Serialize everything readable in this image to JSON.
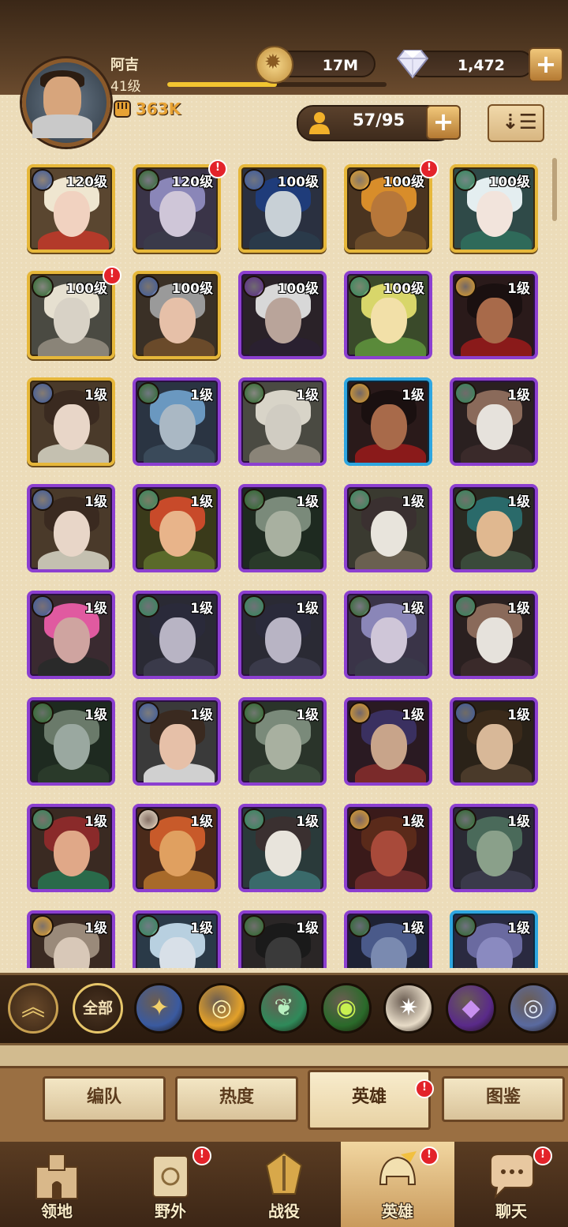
{
  "player": {
    "name": "阿吉",
    "level": "41级",
    "power": "363K",
    "xp_fraction": 0.5
  },
  "resources": {
    "gold": "17M",
    "gems": "1,472",
    "plus": "+"
  },
  "roster": {
    "count": "57/95",
    "plus": "+"
  },
  "heroes": [
    {
      "level": "120级",
      "frame": "gold",
      "faction": "celestial",
      "alert": false,
      "skin": "#f1d2c0",
      "hair": "#efe6d0",
      "body": "#b33a2a",
      "bg": "#5a4630"
    },
    {
      "level": "120级",
      "frame": "gold",
      "faction": "graveborn",
      "alert": true,
      "skin": "#cfc6d8",
      "hair": "#8a86b8",
      "body": "#3a3a4a",
      "bg": "#3a3448"
    },
    {
      "level": "100级",
      "frame": "gold",
      "faction": "celestial",
      "alert": false,
      "skin": "#c8d0d6",
      "hair": "#1f3c7a",
      "body": "#2a3a4a",
      "bg": "#2a3040"
    },
    {
      "level": "100级",
      "frame": "gold",
      "faction": "lightbearer",
      "alert": true,
      "skin": "#b7773a",
      "hair": "#d88d2a",
      "body": "#6a4b2a",
      "bg": "#4a3420"
    },
    {
      "level": "100级",
      "frame": "gold",
      "faction": "wilder",
      "alert": false,
      "skin": "#f2e4dc",
      "hair": "#e4eef0",
      "body": "#2f6a5a",
      "bg": "#2f4a48"
    },
    {
      "level": "100级",
      "frame": "gold",
      "faction": "graveborn",
      "alert": true,
      "skin": "#d8d2c6",
      "hair": "#e6e0d0",
      "body": "#8a8478",
      "bg": "#4a4a42"
    },
    {
      "level": "100级",
      "frame": "gold",
      "faction": "celestial",
      "alert": false,
      "skin": "#e6c0a8",
      "hair": "#9a9a9a",
      "body": "#6a4a2a",
      "bg": "#3a3026"
    },
    {
      "level": "100级",
      "frame": "purple",
      "faction": "hypogean",
      "alert": false,
      "skin": "#b9a49a",
      "hair": "#d8d8d8",
      "body": "#2a2030",
      "bg": "#2a2228"
    },
    {
      "level": "100级",
      "frame": "purple",
      "faction": "wilder",
      "alert": false,
      "skin": "#f2e0a8",
      "hair": "#d8d66a",
      "body": "#5a8a3a",
      "bg": "#3a4a2a"
    },
    {
      "level": "1级",
      "frame": "purple",
      "faction": "lightbearer",
      "alert": false,
      "skin": "#a86a4a",
      "hair": "#1a1010",
      "body": "#8a1a1a",
      "bg": "#2a1a1a"
    },
    {
      "level": "1级",
      "frame": "gold",
      "faction": "celestial",
      "alert": false,
      "skin": "#e8d6c8",
      "hair": "#3a2a20",
      "body": "#c4c0b0",
      "bg": "#4a3a2a"
    },
    {
      "level": "1级",
      "frame": "purple",
      "faction": "graveborn",
      "alert": false,
      "skin": "#aab8c4",
      "hair": "#6a98c0",
      "body": "#3a4a5a",
      "bg": "#2a3442"
    },
    {
      "level": "1级",
      "frame": "purple",
      "faction": "graveborn",
      "alert": false,
      "skin": "#d0ccc2",
      "hair": "#d8d4c8",
      "body": "#8a8478",
      "bg": "#4a4a42"
    },
    {
      "level": "1级",
      "frame": "blue",
      "faction": "lightbearer",
      "alert": false,
      "skin": "#a86a4a",
      "hair": "#1a1010",
      "body": "#8a1a1a",
      "bg": "#2a1a1a"
    },
    {
      "level": "1级",
      "frame": "purple",
      "faction": "wilder",
      "alert": false,
      "skin": "#e6e2dc",
      "hair": "#8a6a5a",
      "body": "#3a2a2a",
      "bg": "#2a2020"
    },
    {
      "level": "1级",
      "frame": "purple",
      "faction": "celestial",
      "alert": false,
      "skin": "#e8d6c8",
      "hair": "#3a2a20",
      "body": "#c4c0b0",
      "bg": "#4a3a2a"
    },
    {
      "level": "1级",
      "frame": "purple",
      "faction": "wilder",
      "alert": false,
      "skin": "#e8b48a",
      "hair": "#c84a2a",
      "body": "#5a6a2a",
      "bg": "#3a3a1a"
    },
    {
      "level": "1级",
      "frame": "purple",
      "faction": "graveborn",
      "alert": false,
      "skin": "#a8b0a0",
      "hair": "#7a8a7a",
      "body": "#2a3a2a",
      "bg": "#1e2a20"
    },
    {
      "level": "1级",
      "frame": "purple",
      "faction": "wilder",
      "alert": false,
      "skin": "#e8e4dc",
      "hair": "#3a3030",
      "body": "#6a6050",
      "bg": "#3a3a30"
    },
    {
      "level": "1级",
      "frame": "purple",
      "faction": "wilder",
      "alert": false,
      "skin": "#e0b890",
      "hair": "#2a6a6a",
      "body": "#3a4a3a",
      "bg": "#2a2a22"
    },
    {
      "level": "1级",
      "frame": "purple",
      "faction": "celestial",
      "alert": false,
      "skin": "#cfa4a0",
      "hair": "#e05aa0",
      "body": "#2a2a2a",
      "bg": "#3a2a30"
    },
    {
      "level": "1级",
      "frame": "purple",
      "faction": "wilder",
      "alert": false,
      "skin": "#b8b4c4",
      "hair": "#2a2a3a",
      "body": "#3a3a4a",
      "bg": "#2a2a34"
    },
    {
      "level": "1级",
      "frame": "purple",
      "faction": "wilder",
      "alert": false,
      "skin": "#b8b4c4",
      "hair": "#2a2a3a",
      "body": "#3a3a4a",
      "bg": "#2a2a34"
    },
    {
      "level": "1级",
      "frame": "purple",
      "faction": "graveborn",
      "alert": false,
      "skin": "#cfc6d8",
      "hair": "#8a86b8",
      "body": "#3a3a4a",
      "bg": "#3a3448"
    },
    {
      "level": "1级",
      "frame": "purple",
      "faction": "wilder",
      "alert": false,
      "skin": "#e6e2dc",
      "hair": "#8a6a5a",
      "body": "#3a2a2a",
      "bg": "#2a2020"
    },
    {
      "level": "1级",
      "frame": "purple",
      "faction": "graveborn",
      "alert": false,
      "skin": "#9aa8a0",
      "hair": "#6a7a6a",
      "body": "#2a3a2a",
      "bg": "#1e2a20"
    },
    {
      "level": "1级",
      "frame": "purple",
      "faction": "celestial",
      "alert": false,
      "skin": "#e6c0a8",
      "hair": "#3a2a20",
      "body": "#d0d0d0",
      "bg": "#3a3a3a"
    },
    {
      "level": "1级",
      "frame": "purple",
      "faction": "graveborn",
      "alert": false,
      "skin": "#a8b0a0",
      "hair": "#7a8a7a",
      "body": "#3a4a3a",
      "bg": "#2a342a"
    },
    {
      "level": "1级",
      "frame": "purple",
      "faction": "lightbearer",
      "alert": false,
      "skin": "#c8a48a",
      "hair": "#3a3060",
      "body": "#7a2a2a",
      "bg": "#2a1a22"
    },
    {
      "level": "1级",
      "frame": "purple",
      "faction": "celestial",
      "alert": false,
      "skin": "#d8b898",
      "hair": "#3a2a1a",
      "body": "#4a3a2a",
      "bg": "#2a2218"
    },
    {
      "level": "1级",
      "frame": "purple",
      "faction": "wilder",
      "alert": false,
      "skin": "#e0a888",
      "hair": "#8a2a2a",
      "body": "#2a6a4a",
      "bg": "#3a2a22"
    },
    {
      "level": "1级",
      "frame": "purple",
      "faction": "dimensional",
      "alert": false,
      "skin": "#e0a060",
      "hair": "#c85a2a",
      "body": "#a86a2a",
      "bg": "#4a2a1a"
    },
    {
      "level": "1级",
      "frame": "purple",
      "faction": "wilder",
      "alert": false,
      "skin": "#e8e4dc",
      "hair": "#3a3030",
      "body": "#3a6a6a",
      "bg": "#2a3a3a"
    },
    {
      "level": "1级",
      "frame": "purple",
      "faction": "lightbearer",
      "alert": false,
      "skin": "#a84a3a",
      "hair": "#5a2a1a",
      "body": "#6a2a2a",
      "bg": "#3a1a1a"
    },
    {
      "level": "1级",
      "frame": "purple",
      "faction": "graveborn",
      "alert": false,
      "skin": "#8aa08a",
      "hair": "#4a6a5a",
      "body": "#3a3a4a",
      "bg": "#2a2a34"
    },
    {
      "level": "1级",
      "frame": "purple",
      "faction": "lightbearer",
      "alert": false,
      "skin": "#d8c8b8",
      "hair": "#9a8a7a",
      "body": "#6a4a3a",
      "bg": "#3a2a22"
    },
    {
      "level": "1级",
      "frame": "purple",
      "faction": "wilder",
      "alert": false,
      "skin": "#d8e0e8",
      "hair": "#b8d0e0",
      "body": "#4a5a6a",
      "bg": "#2a3a48"
    },
    {
      "level": "1级",
      "frame": "purple",
      "faction": "graveborn",
      "alert": false,
      "skin": "#3a3a3a",
      "hair": "#1a1a1a",
      "body": "#2a2a2a",
      "bg": "#2a2626"
    },
    {
      "level": "1级",
      "frame": "purple",
      "faction": "graveborn",
      "alert": false,
      "skin": "#7a8ab0",
      "hair": "#4a5a8a",
      "body": "#2a3050",
      "bg": "#1e2234"
    },
    {
      "level": "1级",
      "frame": "blue",
      "faction": "graveborn",
      "alert": false,
      "skin": "#8a8ac0",
      "hair": "#6a6aa0",
      "body": "#3a3a5a",
      "bg": "#2a2a40"
    }
  ],
  "filters": {
    "all": "全部",
    "factions": [
      {
        "name": "celestial",
        "color": "#3a5aa0",
        "glyph": "✦",
        "glyph_color": "#f2d06a"
      },
      {
        "name": "lightbearer",
        "color": "#e3a12a",
        "glyph": "◎",
        "glyph_color": "#fff3b0"
      },
      {
        "name": "wilder",
        "color": "#2f8a5a",
        "glyph": "❦",
        "glyph_color": "#b8f0c0"
      },
      {
        "name": "graveborn",
        "color": "#2a6a2a",
        "glyph": "◉",
        "glyph_color": "#c8f050"
      },
      {
        "name": "dimensional",
        "color": "#e8dcc8",
        "glyph": "✷",
        "glyph_color": "#ffffff"
      },
      {
        "name": "hypogean",
        "color": "#5a2a8a",
        "glyph": "◆",
        "glyph_color": "#c890f0"
      },
      {
        "name": "celestial-alt",
        "color": "#5a6aa0",
        "glyph": "◎",
        "glyph_color": "#e0e8f8"
      }
    ]
  },
  "subtabs": [
    "编队",
    "热度",
    "英雄",
    "图鉴"
  ],
  "nav": [
    "领地",
    "野外",
    "战役",
    "英雄",
    "聊天"
  ],
  "colors": {
    "faction_celestial": "#3a5aa0",
    "faction_lightbearer": "#e3a12a",
    "faction_wilder": "#2f8a5a",
    "faction_graveborn": "#2a6a2a",
    "faction_hypogean": "#5a2a8a",
    "faction_dimensional": "#e8dcc8",
    "alert": "#e3232a"
  }
}
